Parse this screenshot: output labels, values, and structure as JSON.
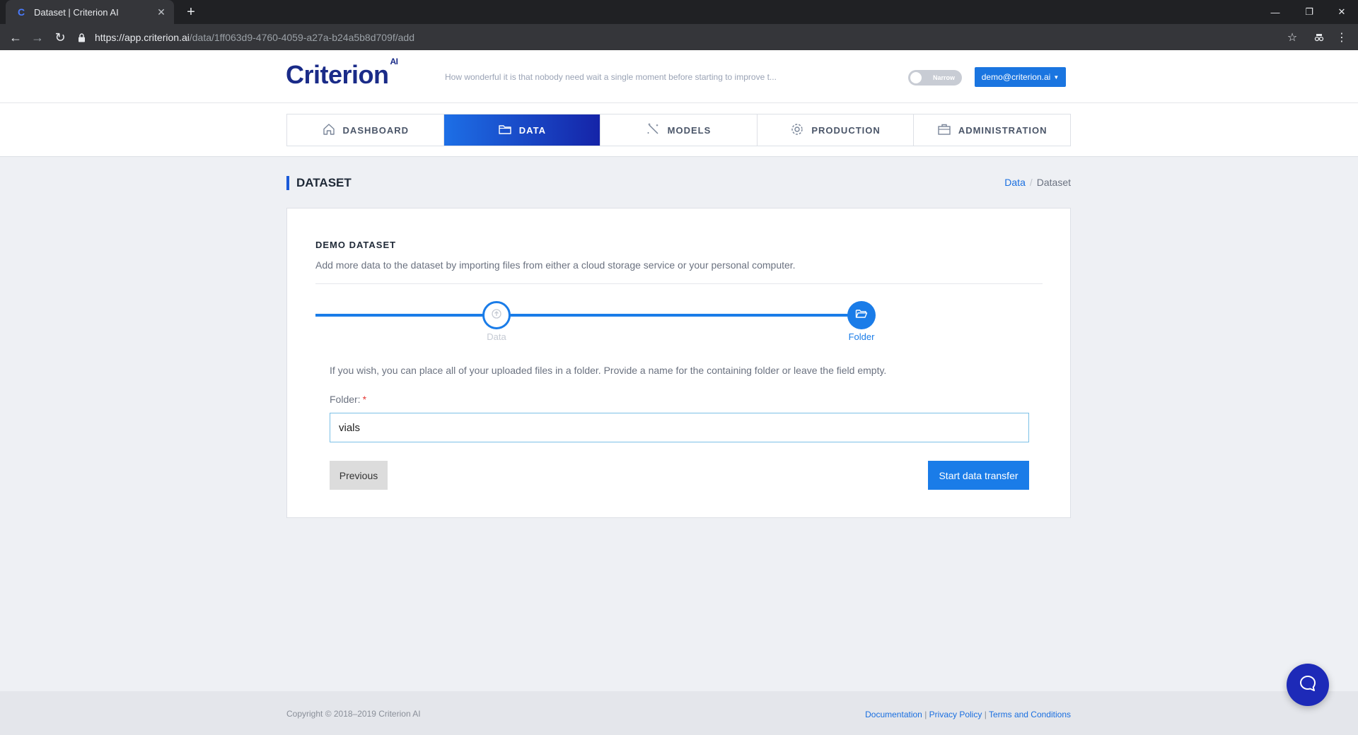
{
  "browser": {
    "tab_title": "Dataset | Criterion AI",
    "url_host": "https://app.criterion.ai",
    "url_path": "/data/1ff063d9-4760-4059-a27a-b24a5b8d709f/add"
  },
  "header": {
    "logo_text": "Criterion",
    "logo_sup": "AI",
    "tagline": "How wonderful it is that nobody need wait a single moment before starting to improve t...",
    "toggle_label": "Narrow",
    "user_email": "demo@criterion.ai"
  },
  "nav": {
    "tabs": [
      {
        "label": "DASHBOARD",
        "icon": "home-icon",
        "active": false
      },
      {
        "label": "DATA",
        "icon": "folder-icon",
        "active": true
      },
      {
        "label": "MODELS",
        "icon": "magic-wand-icon",
        "active": false
      },
      {
        "label": "PRODUCTION",
        "icon": "gear-icon",
        "active": false
      },
      {
        "label": "ADMINISTRATION",
        "icon": "briefcase-icon",
        "active": false
      }
    ]
  },
  "page": {
    "title": "DATASET",
    "breadcrumb": {
      "link": "Data",
      "separator": "/",
      "current": "Dataset"
    }
  },
  "card": {
    "title": "DEMO DATASET",
    "description": "Add more data to the dataset by importing files from either a cloud storage service or your personal computer.",
    "steps": [
      {
        "label": "Data",
        "icon": "upload-icon",
        "state": "completed"
      },
      {
        "label": "Folder",
        "icon": "folder-open-icon",
        "state": "active"
      }
    ],
    "hint": "If you wish, you can place all of your uploaded files in a folder. Provide a name for the containing folder or leave the field empty.",
    "folder_label": "Folder:",
    "required_marker": "*",
    "folder_value": "vials",
    "previous_label": "Previous",
    "start_label": "Start data transfer"
  },
  "footer": {
    "copyright": "Copyright © 2018–2019 Criterion AI",
    "links": [
      "Documentation",
      "Privacy Policy",
      "Terms and Conditions"
    ],
    "link_separator": "|"
  },
  "colors": {
    "brand_navy": "#1a2b88",
    "primary_blue": "#1a7ce8",
    "nav_gradient_start": "#1d6fe6",
    "nav_gradient_end": "#1524a8",
    "chat_button": "#1d2ab8"
  }
}
